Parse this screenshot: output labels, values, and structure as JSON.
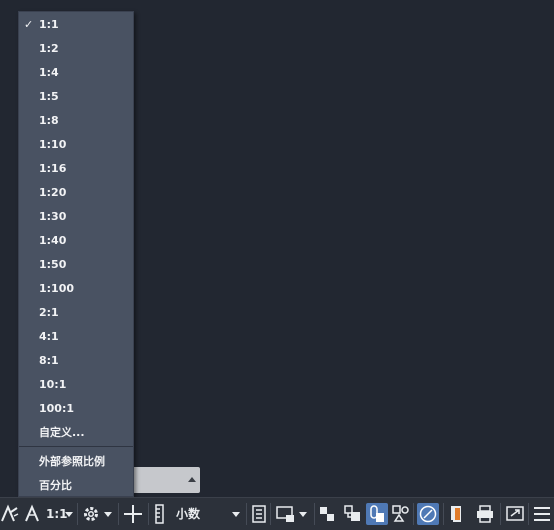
{
  "scale_menu": {
    "selected": "1:1",
    "items": [
      {
        "label": "1:1",
        "checked": true
      },
      {
        "label": "1:2"
      },
      {
        "label": "1:4"
      },
      {
        "label": "1:5"
      },
      {
        "label": "1:8"
      },
      {
        "label": "1:10"
      },
      {
        "label": "1:16"
      },
      {
        "label": "1:20"
      },
      {
        "label": "1:30"
      },
      {
        "label": "1:40"
      },
      {
        "label": "1:50"
      },
      {
        "label": "1:100"
      },
      {
        "label": "2:1"
      },
      {
        "label": "4:1"
      },
      {
        "label": "8:1"
      },
      {
        "label": "10:1"
      },
      {
        "label": "100:1"
      },
      {
        "label": "自定义..."
      }
    ],
    "extra_items": [
      {
        "label": "外部参照比例"
      },
      {
        "label": "百分比"
      }
    ],
    "checkmark": "✓"
  },
  "status_bar": {
    "annotation_scale": "1:1",
    "units": "小数",
    "icons": [
      "annotation-visibility-icon",
      "annotation-autoscale-icon",
      "workspace-gear-icon",
      "plus-icon",
      "units-ruler-icon",
      "quick-properties-icon",
      "selection-cycling-icon",
      "isolate-objects-icon",
      "lock-ui-icon",
      "hardware-accel-icon",
      "clean-screen-icon",
      "customize-menu-icon"
    ]
  },
  "colors": {
    "menu_bg": "#495262",
    "canvas_bg": "#222731",
    "toolbar_bg": "#2c313a",
    "highlight": "#4f79b5"
  }
}
